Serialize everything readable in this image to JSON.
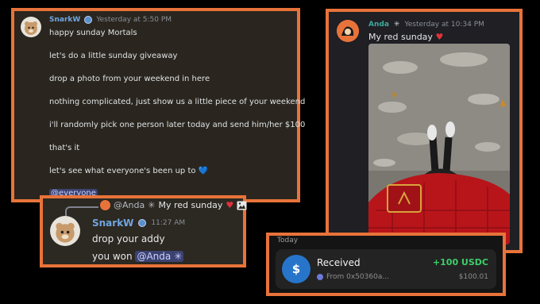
{
  "message1": {
    "username": "SnarkW",
    "timestamp": "Yesterday at 5:50 PM",
    "lines": [
      "happy sunday Mortals",
      "let's do a little sunday giveaway",
      "drop a photo from your weekend in here",
      "nothing complicated, just show us a little piece of your weekend",
      "i'll randomly pick one person later today and send him/her $100",
      "that's it",
      "let's see what everyone's been up to"
    ],
    "heart": "💙",
    "mention": "@everyone"
  },
  "reply": {
    "ref_user": "@Anda",
    "ref_sparkle": "✳",
    "ref_text": "My red sunday",
    "ref_heart": "♥",
    "username": "SnarkW",
    "timestamp": "11:27 AM",
    "line1": "drop your addy",
    "line2_prefix": "you won",
    "line2_mention": "@Anda",
    "line2_sparkle": "✳"
  },
  "message2": {
    "username": "Anda",
    "sparkle": "✳",
    "timestamp": "Yesterday at 10:34 PM",
    "text": "My red sunday",
    "heart": "♥"
  },
  "wallet": {
    "section": "Today",
    "title": "Received",
    "from": "From 0x50360a...",
    "amount": "+100 USDC",
    "usd": "$100.01",
    "coin_symbol": "$"
  },
  "colors": {
    "accent_border": "#e8733a",
    "username_blue": "#70a6e0",
    "username_teal": "#3fa8a0",
    "positive_green": "#3fce6a",
    "heart_red": "#e0323c"
  }
}
